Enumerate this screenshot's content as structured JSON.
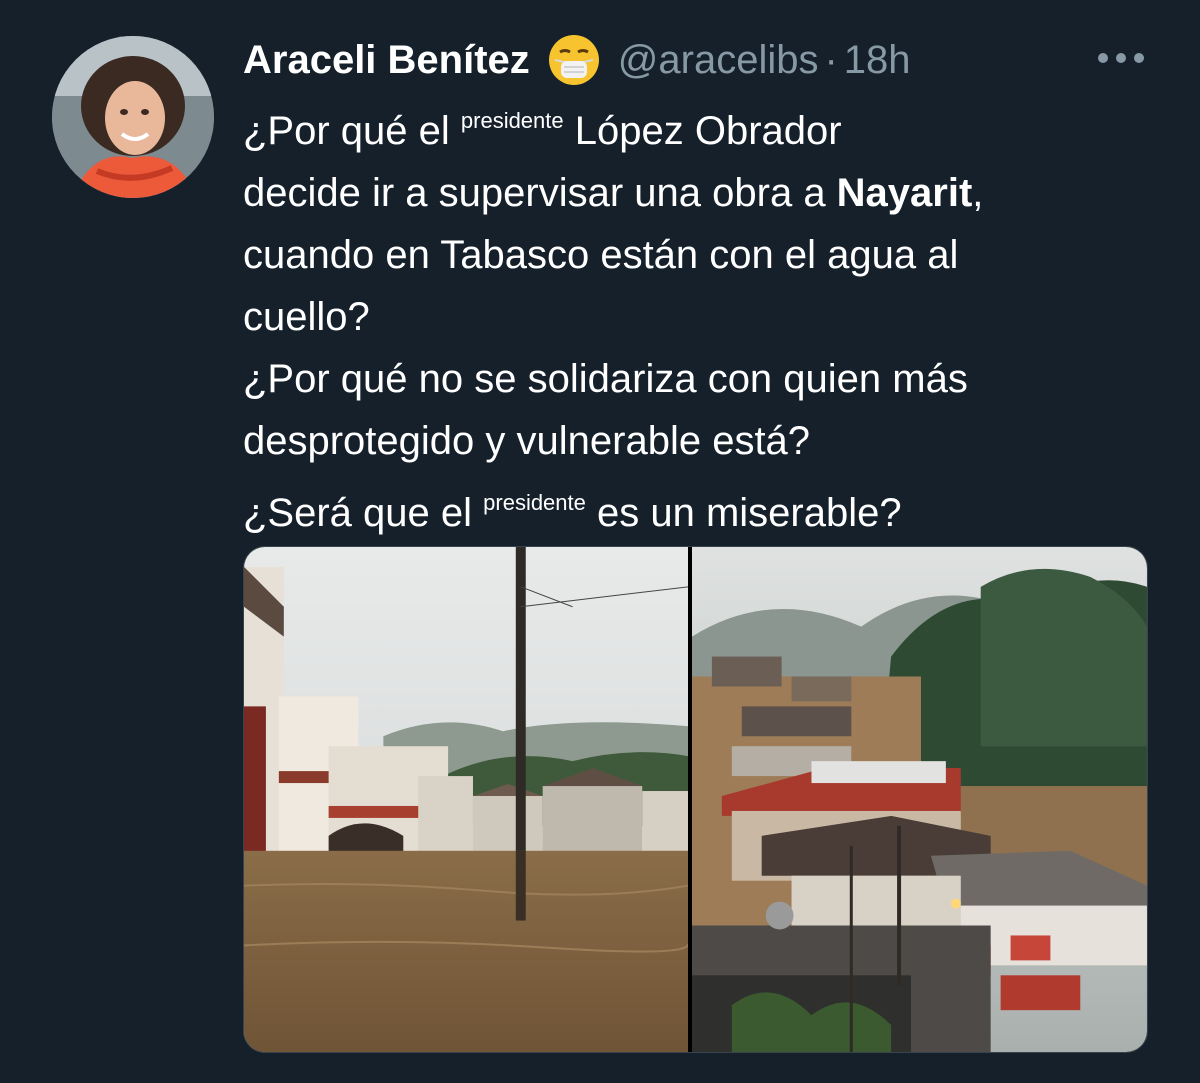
{
  "tweet": {
    "display_name": "Araceli Benítez",
    "handle": "@aracelibs",
    "separator": "·",
    "timestamp": "18h",
    "emoji_icon": "face-with-medical-mask-icon",
    "more_icon": "more-horizontal-icon",
    "text": {
      "l1_pre": "¿Por qué el ",
      "l1_sup": "presidente",
      "l1_post": " López Obrador",
      "l2_pre": "decide ir a supervisar una obra a ",
      "l2_bold": "Nayarit",
      "l2_post": ",",
      "l3": "cuando en Tabasco están con el agua al",
      "l4": "cuello?",
      "l5": "¿Por qué no se solidariza con quien más",
      "l6": "desprotegido y vulnerable está?",
      "l7_pre": "¿Será que el ",
      "l7_sup": "presidente",
      "l7_post": " es un miserable?"
    },
    "media": [
      "flooded-street-photo",
      "flooded-town-aerial-photo"
    ]
  },
  "colors": {
    "background": "#15202b",
    "primary_text": "#ffffff",
    "secondary_text": "#8899a6"
  }
}
